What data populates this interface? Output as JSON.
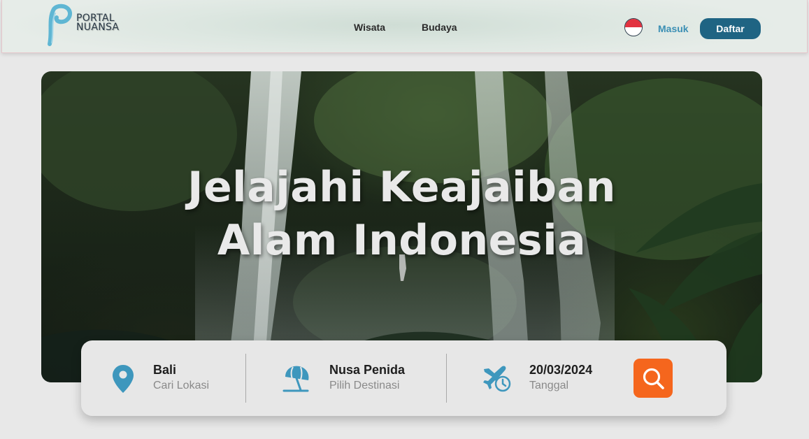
{
  "brand": {
    "line1": "PORTAL",
    "line2": "NUANSA",
    "accent_color": "#5fb6d3"
  },
  "nav": {
    "links": [
      {
        "label": "Wisata"
      },
      {
        "label": "Budaya"
      }
    ],
    "language_flag": "indonesia-flag-icon",
    "login_label": "Masuk",
    "register_label": "Daftar",
    "register_color": "#1f6483",
    "login_color": "#3b8fb4"
  },
  "hero": {
    "title_line1": "Jelajahi Keajaiban",
    "title_line2": "Alam Indonesia",
    "background": "waterfall-jungle-photo"
  },
  "search": {
    "location": {
      "value": "Bali",
      "placeholder": "Cari Lokasi",
      "icon": "map-pin-icon"
    },
    "destination": {
      "value": "Nusa Penida",
      "placeholder": "Pilih Destinasi",
      "icon": "beach-umbrella-icon"
    },
    "date": {
      "value": "20/03/2024",
      "placeholder": "Tanggal",
      "icon": "flight-clock-icon"
    },
    "button_icon": "search-icon",
    "button_color": "#f5661d",
    "icon_color": "#3e97bd"
  }
}
